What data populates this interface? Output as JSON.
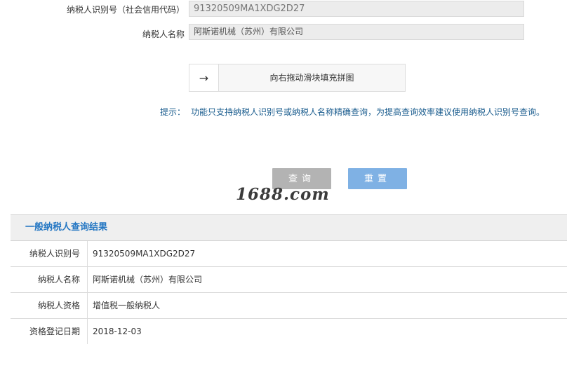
{
  "form": {
    "taxpayer_id_label": "纳税人识别号（社会信用代码）",
    "taxpayer_id_value": "91320509MA1XDG2D27",
    "taxpayer_name_label": "纳税人名称",
    "taxpayer_name_value": "阿斯诺机械（苏州）有限公司"
  },
  "slider": {
    "handle_icon": "arrow-right-icon",
    "handle_glyph": "→",
    "text": "向右拖动滑块填充拼图"
  },
  "hint": {
    "label": "提示：",
    "text": "功能只支持纳税人识别号或纳税人名称精确查询，为提高查询效率建议使用纳税人识别号查询。"
  },
  "buttons": {
    "query_label": "查询",
    "reset_label": "重置"
  },
  "watermark": "1688.com",
  "result": {
    "title": "一般纳税人查询结果",
    "rows": [
      {
        "label": "纳税人识别号",
        "value": "91320509MA1XDG2D27"
      },
      {
        "label": "纳税人名称",
        "value": "阿斯诺机械（苏州）有限公司"
      },
      {
        "label": "纳税人资格",
        "value": "增值税一般纳税人"
      },
      {
        "label": "资格登记日期",
        "value": "2018-12-03"
      }
    ]
  },
  "colors": {
    "hint_text": "#1a5c8e",
    "result_title": "#2577c3",
    "query_button": "#b3b3b3",
    "reset_button": "#7fb1e4"
  }
}
